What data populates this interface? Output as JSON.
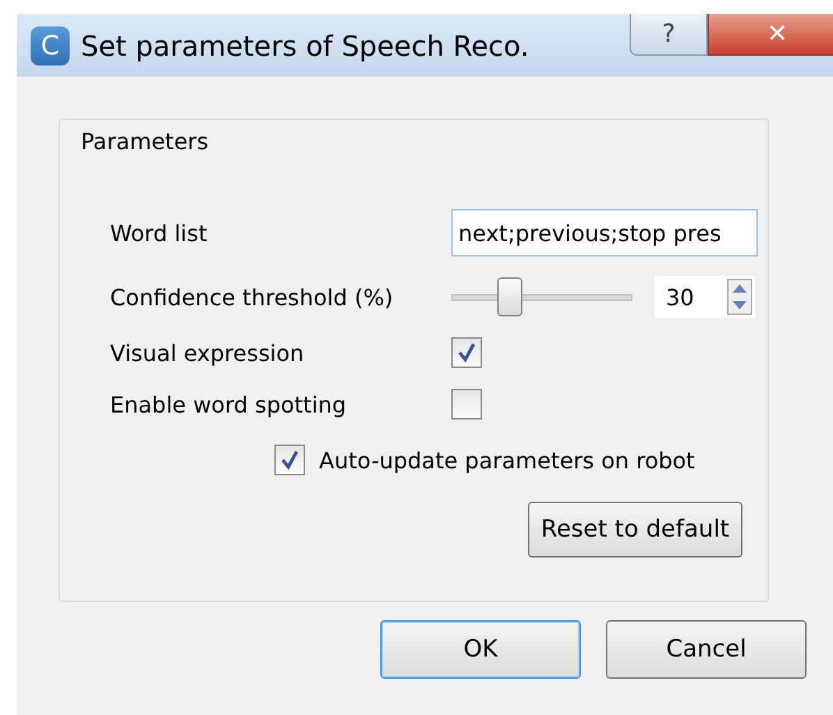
{
  "window": {
    "title": "Set parameters of Speech Reco.",
    "app_icon": "C",
    "help_button": "?",
    "close_button": "✕"
  },
  "group": {
    "title": "Parameters"
  },
  "word_list": {
    "label": "Word list",
    "value": "next;previous;stop pres"
  },
  "confidence": {
    "label": "Confidence threshold (%)",
    "level": 0.32,
    "value": "30"
  },
  "options": [
    {
      "label": "Visual expression",
      "checked": true
    },
    {
      "label": "Enable word spotting",
      "checked": false
    }
  ],
  "auto_update": {
    "label": "Auto-update parameters on robot",
    "checked": true
  },
  "reset_button": "Reset to default",
  "buttons": [
    {
      "label": "OK",
      "default": true
    },
    {
      "label": "Cancel",
      "default": false
    }
  ]
}
